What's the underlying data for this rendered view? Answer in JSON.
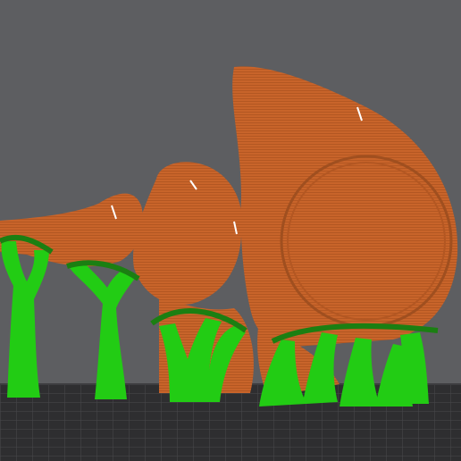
{
  "viewport": {
    "kind": "3d-slicer-preview",
    "background_color": "#5d5e61",
    "build_plate_color": "#2e2e30",
    "plate_grid_color": "#4a4a4e"
  },
  "model": {
    "name": "",
    "object_color": "#c8642a",
    "object_shadow_color": "#a04f1f",
    "support_color": "#22cc14",
    "support_dark_color": "#1b7f12"
  }
}
